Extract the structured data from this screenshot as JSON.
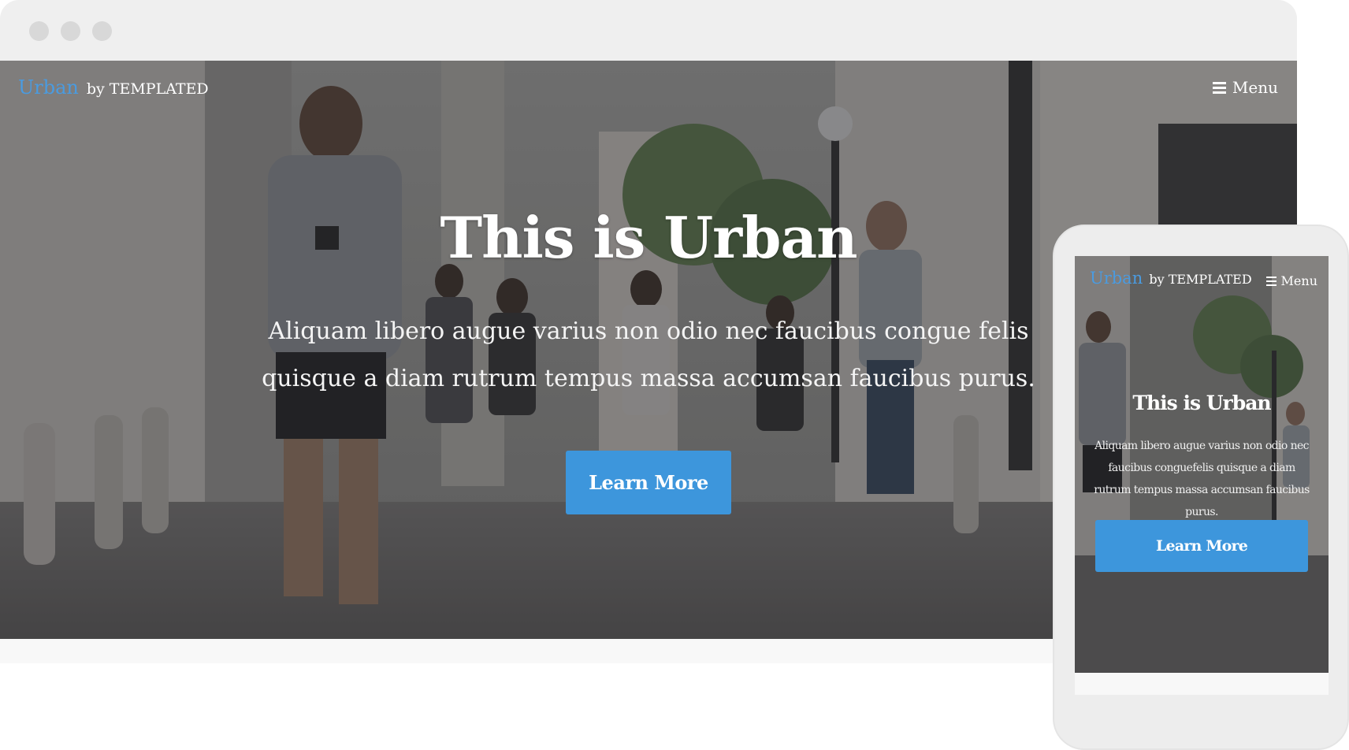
{
  "desktop": {
    "brand": {
      "name": "Urban",
      "suffix": "by TEMPLATED"
    },
    "menu_label": "Menu",
    "hero": {
      "title": "This is Urban",
      "text": "Aliquam libero augue varius non odio nec faucibus congue felis quisque a diam rutrum tempus massa accumsan faucibus purus.",
      "button_label": "Learn More"
    }
  },
  "mobile": {
    "brand": {
      "name": "Urban",
      "suffix": "by TEMPLATED"
    },
    "menu_label": "Menu",
    "hero": {
      "title": "This is Urban",
      "text": "Aliquam libero augue varius non odio nec faucibus conguefelis quisque a diam rutrum tempus massa accumsan faucibus purus.",
      "button_label": "Learn More"
    }
  },
  "colors": {
    "accent": "#4a9be0",
    "button": "#3d96dc",
    "frame": "#efefef"
  },
  "icons": {
    "window_controls": [
      "window-dot-icon",
      "window-dot-icon",
      "window-dot-icon"
    ],
    "menu": "hamburger-icon"
  }
}
